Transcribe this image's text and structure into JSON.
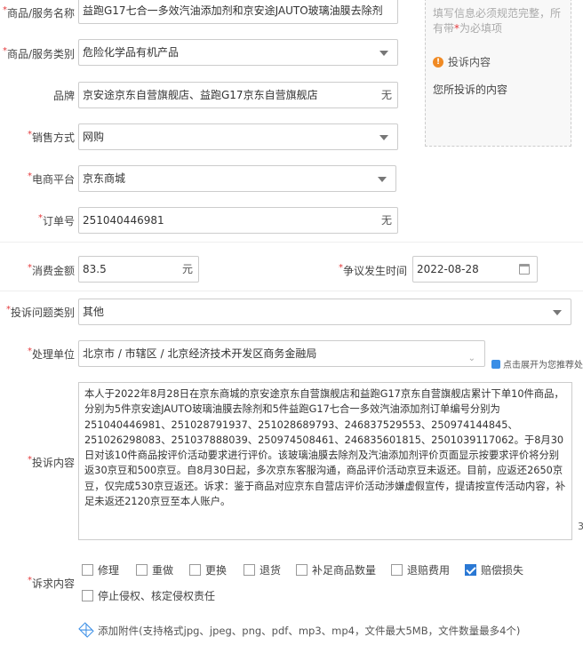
{
  "form": {
    "name": {
      "label": "商品/服务名称",
      "value": "益跑G17七合一多效汽油添加剂和京安途JAUTO玻璃油膜去除剂"
    },
    "category": {
      "label": "商品/服务类别",
      "value": "危险化学品有机产品"
    },
    "brand": {
      "label": "品牌",
      "value": "京安途京东自营旗舰店、益跑G17京东自营旗舰店",
      "suffix": "无"
    },
    "sales": {
      "label": "销售方式",
      "value": "网购"
    },
    "platform": {
      "label": "电商平台",
      "value": "京东商城"
    },
    "order": {
      "label": "订单号",
      "value": "251040446981",
      "suffix": "无"
    },
    "amount": {
      "label": "消费金额",
      "value": "83.5",
      "suffix": "元"
    },
    "date": {
      "label": "争议发生时间",
      "value": "2022-08-28"
    },
    "issue_type": {
      "label": "投诉问题类别",
      "value": "其他"
    },
    "unit": {
      "label": "处理单位",
      "value": "北京市 / 市辖区 / 北京经济技术开发区商务金融局",
      "hint": "点击展开为您推荐处"
    },
    "content": {
      "label": "投诉内容",
      "value": "本人于2022年8月28日在京东商城的京安途京东自营旗舰店和益跑G17京东自营旗舰店累计下单10件商品，分别为5件京安途JAUTO玻璃油膜去除剂和5件益跑G17七合一多效汽油添加剂订单编号分别为251040446981、251028791937、251028689793、246837529553、250974144845、251026298083、251037888039、250974508461、246835601815、2501039117062。于8月30日对该10件商品按评价活动要求进行评价。该玻璃油膜去除剂及汽油添加剂评价页面显示按要求评价将分别返30京豆和500京豆。自8月30日起，多次京东客服沟通，商品评价活动京豆未返还。目前，应返还2650京豆，仅完成530京豆返还。诉求：鉴于商品对应京东自营店评价活动涉嫌虚假宣传，提请按宣传活动内容，补足未返还2120京豆至本人账户。",
      "counter": "3"
    },
    "demands": {
      "label": "诉求内容",
      "options": [
        {
          "label": "修理",
          "checked": false
        },
        {
          "label": "重做",
          "checked": false
        },
        {
          "label": "更换",
          "checked": false
        },
        {
          "label": "退货",
          "checked": false
        },
        {
          "label": "补足商品数量",
          "checked": false
        },
        {
          "label": "退赔费用",
          "checked": false
        },
        {
          "label": "赔偿损失",
          "checked": true
        },
        {
          "label": "停止侵权、核定侵权责任",
          "checked": false
        }
      ]
    },
    "attachment": "添加附件(支持格式jpg、jpeg、png、pdf、mp3、mp4，文件最大5MB，文件数量最多4个)",
    "required_mark": "*"
  },
  "side": {
    "note_a": "填写信息必须规范完整，所有带",
    "note_star": "*",
    "note_b": "为必填项",
    "section_title": "投诉内容",
    "section_text": "您所投诉的内容"
  },
  "colors": {
    "required": "#e4393c",
    "info": "#f08a24",
    "checkbox": "#2a78d4"
  }
}
